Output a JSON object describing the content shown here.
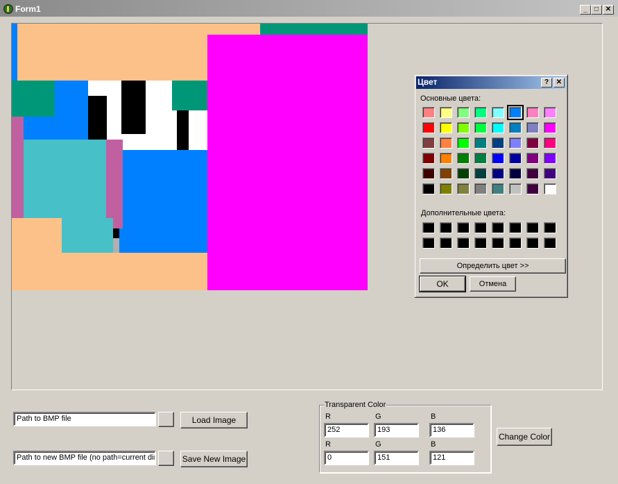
{
  "window": {
    "title": "Form1",
    "min_glyph": "_",
    "max_glyph": "□",
    "close_glyph": "✕"
  },
  "bottom": {
    "path_input": "Path to BMP file",
    "load_button": "Load Image",
    "new_path_input": "Path to new BMP file (no path=current dir)",
    "save_button": "Save New Image",
    "browse_label": "",
    "change_color_button": "Change Color"
  },
  "transparent": {
    "caption": "Transparent Color",
    "r_label": "R",
    "g_label": "G",
    "b_label": "B",
    "r1": "252",
    "g1": "193",
    "b1": "136",
    "r2": "0",
    "g2": "151",
    "b2": "121"
  },
  "dialog": {
    "title": "Цвет",
    "help_glyph": "?",
    "close_glyph": "✕",
    "basic_label": "Основные цвета:",
    "custom_label": "Дополнительные цвета:",
    "define_button": "Определить цвет >>",
    "ok_button": "OK",
    "cancel_button": "Отмена",
    "basic_colors": [
      [
        "#ff8080",
        "#ffff80",
        "#80ff80",
        "#00ff80",
        "#80ffff",
        "#0080ff",
        "#ff80c0",
        "#ff80ff"
      ],
      [
        "#ff0000",
        "#ffff00",
        "#80ff00",
        "#00ff40",
        "#00ffff",
        "#0080c0",
        "#8080c0",
        "#ff00ff"
      ],
      [
        "#804040",
        "#ff8040",
        "#00ff00",
        "#008080",
        "#004080",
        "#8080ff",
        "#800040",
        "#ff0080"
      ],
      [
        "#800000",
        "#ff8000",
        "#008000",
        "#008040",
        "#0000ff",
        "#0000a0",
        "#800080",
        "#8000ff"
      ],
      [
        "#400000",
        "#804000",
        "#004000",
        "#004040",
        "#000080",
        "#000040",
        "#400040",
        "#400080"
      ],
      [
        "#000000",
        "#808000",
        "#808040",
        "#808080",
        "#408080",
        "#c0c0c0",
        "#400040",
        "#ffffff"
      ]
    ],
    "selected_index": [
      0,
      5
    ],
    "custom_colors": [
      [
        "#000000",
        "#000000",
        "#000000",
        "#000000",
        "#000000",
        "#000000",
        "#000000",
        "#000000"
      ],
      [
        "#000000",
        "#000000",
        "#000000",
        "#000000",
        "#000000",
        "#000000",
        "#000000",
        "#000000"
      ]
    ]
  },
  "image_colors": {
    "peach": "#fcc188",
    "teal": "#009779",
    "magenta": "#ff00ff",
    "blue": "#0080ff",
    "cyan": "#48c0c8",
    "pink": "#c060a0",
    "black": "#000000",
    "white": "#ffffff",
    "grey": "#b0b0b0"
  }
}
